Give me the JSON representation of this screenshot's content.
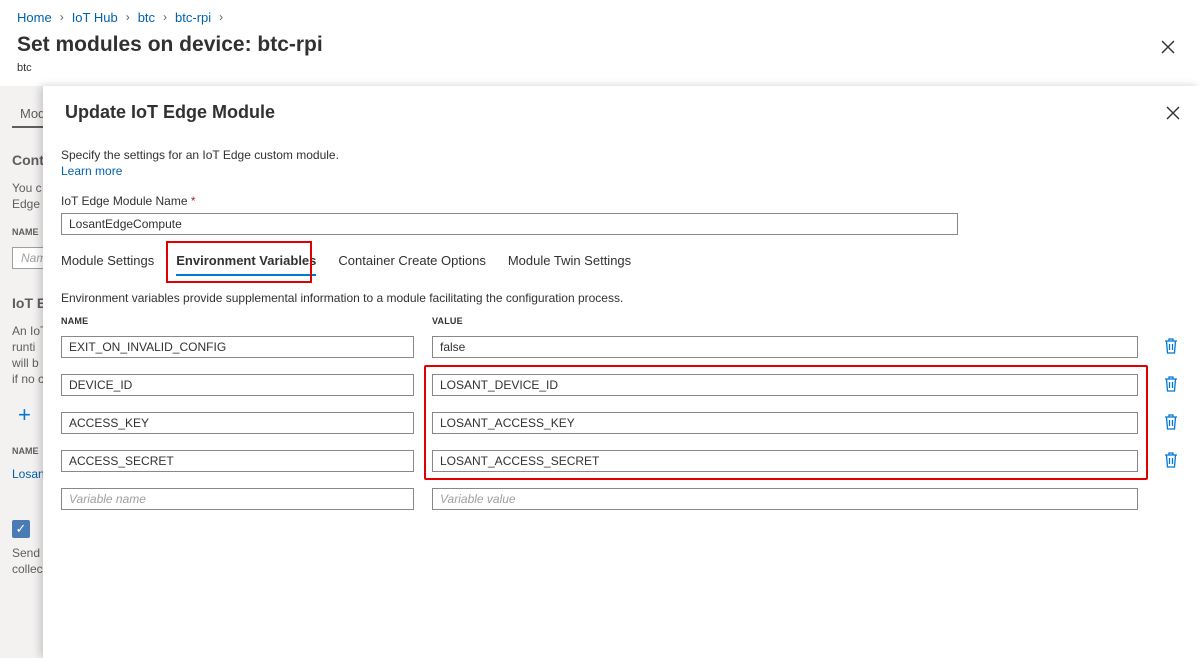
{
  "breadcrumb": [
    {
      "label": "Home"
    },
    {
      "label": "IoT Hub"
    },
    {
      "label": "btc"
    },
    {
      "label": "btc-rpi"
    }
  ],
  "page": {
    "title": "Set modules on device: btc-rpi",
    "subtitle": "btc"
  },
  "behind": {
    "tab": "Mod",
    "heading1": "Cont",
    "text1a": "You c",
    "text1b": "Edge",
    "name_label": "NAME",
    "input_placeholder": "Nam",
    "heading2": "IoT E",
    "text2a": "An IoT",
    "text2b": "runti",
    "text2c": "will b",
    "text2d": "if no c",
    "add": "+",
    "name_label2": "NAME",
    "link": "Losan",
    "check": "✓",
    "text3a": "Send",
    "text3b": "collec"
  },
  "panel": {
    "title": "Update IoT Edge Module",
    "description": "Specify the settings for an IoT Edge custom module.",
    "learn_more": "Learn more",
    "module_name_label": "IoT Edge Module Name",
    "required_marker": "*",
    "module_name_value": "LosantEdgeCompute",
    "tabs": [
      {
        "label": "Module Settings"
      },
      {
        "label": "Environment Variables"
      },
      {
        "label": "Container Create Options"
      },
      {
        "label": "Module Twin Settings"
      }
    ],
    "env_description": "Environment variables provide supplemental information to a module facilitating the configuration process.",
    "col_name": "NAME",
    "col_value": "VALUE",
    "variables": [
      {
        "name": "EXIT_ON_INVALID_CONFIG",
        "value": "false"
      },
      {
        "name": "DEVICE_ID",
        "value": "LOSANT_DEVICE_ID"
      },
      {
        "name": "ACCESS_KEY",
        "value": "LOSANT_ACCESS_KEY"
      },
      {
        "name": "ACCESS_SECRET",
        "value": "LOSANT_ACCESS_SECRET"
      }
    ],
    "new_name_placeholder": "Variable name",
    "new_value_placeholder": "Variable value"
  },
  "colors": {
    "link": "#0062ad",
    "accent": "#0078d4",
    "highlight": "#e00000",
    "trash": "#0078d4"
  }
}
